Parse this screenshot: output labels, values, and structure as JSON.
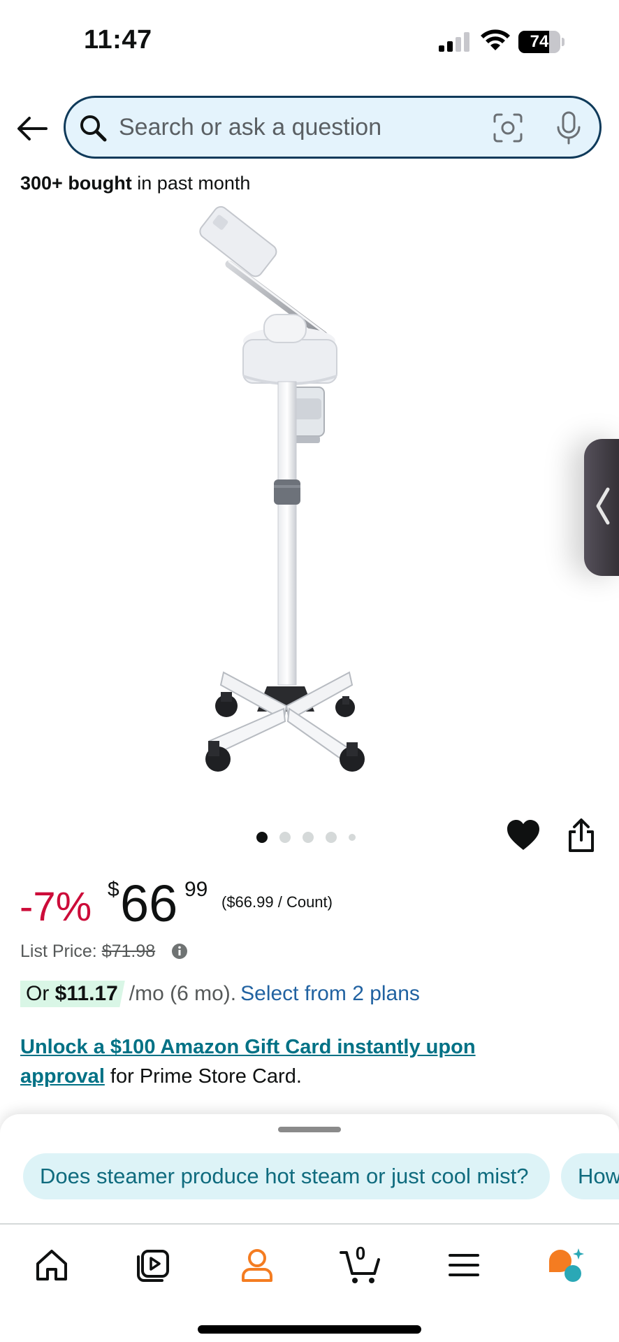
{
  "status_bar": {
    "time": "11:47",
    "battery_percent": "74",
    "battery_level": 0.74
  },
  "search": {
    "placeholder": "Search or ask a question"
  },
  "product": {
    "bought_bold": "300+ bought",
    "bought_rest": " in past month",
    "image_count": 5,
    "active_image": 1
  },
  "price": {
    "discount": "-7%",
    "currency_symbol": "$",
    "whole": "66",
    "fraction": "99",
    "unit_price": "($66.99 / Count)",
    "list_price_label": "List Price: ",
    "list_price_value": "$71.98"
  },
  "installment": {
    "prefix": "Or ",
    "amount": "$11.17",
    "suffix": " /mo (6 mo).",
    "link": "Select from 2 plans"
  },
  "promo": {
    "link_text": "Unlock a $100 Amazon Gift Card instantly upon approval",
    "rest_text": " for Prime Store Card."
  },
  "suggestions": [
    {
      "text": "Does steamer produce hot steam or just cool mist?"
    },
    {
      "text": "How"
    }
  ],
  "tabbar": {
    "cart_count": "0"
  },
  "colors": {
    "discount_red": "#cc0c39",
    "link_teal": "#007185",
    "link_blue": "#2162a1",
    "account_orange": "#f47c21",
    "search_bg": "#e4f3fc",
    "installment_badge": "#d9f6e6"
  },
  "icons": [
    "back-arrow-icon",
    "search-icon",
    "camera-icon",
    "microphone-icon",
    "heart-icon",
    "share-icon",
    "info-icon",
    "home-icon",
    "video-icon",
    "account-icon",
    "cart-icon",
    "menu-icon",
    "rufus-icon",
    "chevron-left-icon"
  ]
}
